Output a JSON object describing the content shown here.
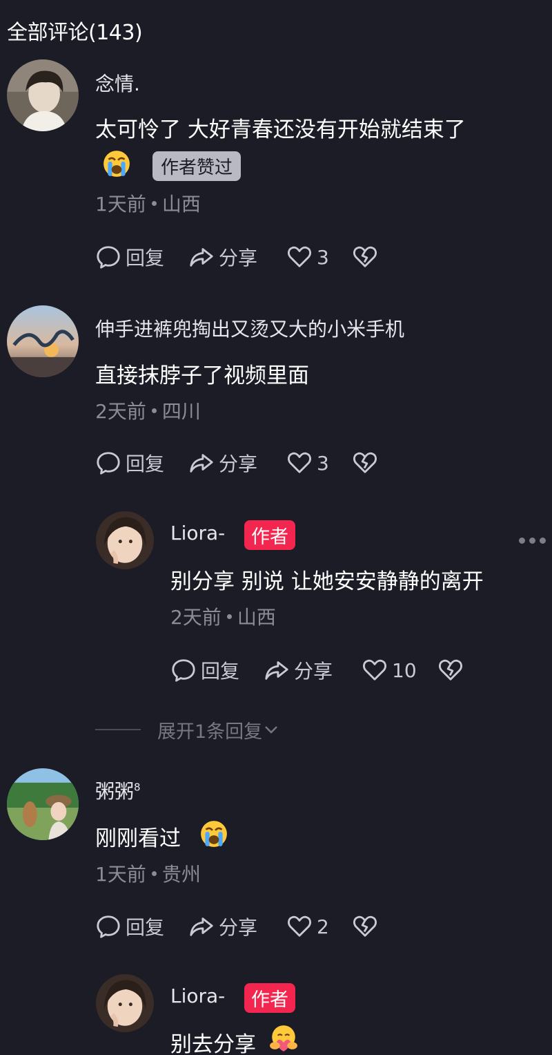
{
  "header": {
    "title": "全部评论(143)"
  },
  "labels": {
    "reply": "回复",
    "share": "分享",
    "author_tag": "作者",
    "author_liked": "作者赞过",
    "expand_replies": "展开1条回复"
  },
  "comments": [
    {
      "user": "念情.",
      "text_line1": "太可怜了 大好青春还没有开始就结束了",
      "time": "1天前",
      "location": "山西",
      "likes": "3"
    },
    {
      "user": "伸手进裤兜掏出又烫又大的小米手机",
      "text": "直接抹脖子了视频里面",
      "time": "2天前",
      "location": "四川",
      "likes": "3",
      "reply": {
        "user": "Liora-",
        "text": "别分享 别说 让她安安静静的离开",
        "time": "2天前",
        "location": "山西",
        "likes": "10"
      }
    },
    {
      "user": "粥粥",
      "user_sup": "8",
      "text": "刚刚看过",
      "time": "1天前",
      "location": "贵州",
      "likes": "2",
      "reply": {
        "user": "Liora-",
        "text": "别去分享"
      }
    }
  ],
  "icons": [
    "comment-bubble-icon",
    "share-arrow-icon",
    "heart-icon",
    "broken-heart-icon",
    "crying-emoji-icon",
    "hug-emoji-icon",
    "chevron-down-icon",
    "more-icon"
  ],
  "colors": {
    "background": "#1b1c26",
    "author_badge": "#f2264e",
    "muted_text": "#8b8c96"
  }
}
